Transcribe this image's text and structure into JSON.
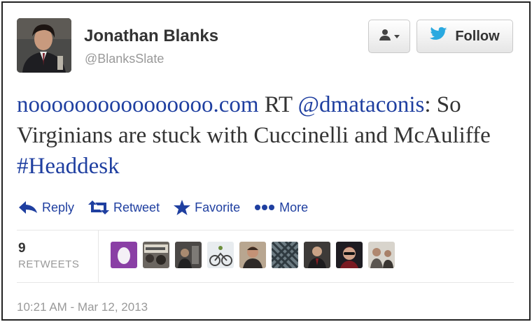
{
  "user": {
    "name": "Jonathan Blanks",
    "handle": "@BlanksSlate",
    "follow_label": "Follow",
    "user_menu_icon": "person-icon"
  },
  "tweet": {
    "parts": [
      {
        "text": "noooooooooooooooo.com",
        "kind": "link"
      },
      {
        "text": " RT ",
        "kind": "text"
      },
      {
        "text": "@dmataconis",
        "kind": "mention"
      },
      {
        "text": ": So Virginians are stuck with Cuccinelli and McAuliffe ",
        "kind": "text"
      },
      {
        "text": "#Headdesk",
        "kind": "hashtag"
      }
    ]
  },
  "actions": {
    "reply": "Reply",
    "retweet": "Retweet",
    "favorite": "Favorite",
    "more": "More"
  },
  "stats": {
    "retweet_count": "9",
    "retweet_label": "RETWEETS",
    "retweeter_avatars": 9
  },
  "timestamp": "10:21 AM - Mar 12, 2013",
  "colors": {
    "link": "#1f3fa0",
    "twitter_blue": "#2aa9e0",
    "muted": "#999999",
    "egg_purple": "#8a3fa5"
  }
}
